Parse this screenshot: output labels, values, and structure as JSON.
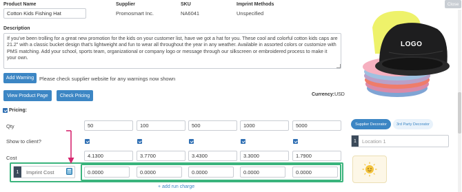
{
  "product": {
    "name_label": "Product Name",
    "name_value": "Cotton Kids Fishing Hat",
    "supplier_label": "Supplier",
    "supplier_value": "Promosmart Inc.",
    "sku_label": "SKU",
    "sku_value": "NA6041",
    "imprint_label": "Imprint Methods",
    "imprint_value": "Unspecified"
  },
  "description": {
    "label": "Description",
    "text": "If you've been trolling for a great new promotion for the kids on your customer list, have we got a hat for you. These cool and colorful cotton kids caps are 21.2\" with a classic bucket design that's lightweight and fun to wear all throughout the year in any weather. Available in assorted colors or customize with PMS matching. Add your school, sports team, organizational or company logo or message through our silkscreen or embroidered process to make it your own."
  },
  "warning": {
    "button": "Add Warning",
    "note": "Please check supplier website for any warnings now shown"
  },
  "actions": {
    "view_product": "View Product Page",
    "check_pricing": "Check Pricing"
  },
  "currency": {
    "label": "Currency:",
    "value": "USD"
  },
  "pricing": {
    "label": "Pricing:",
    "qty_label": "Qty",
    "show_label": "Show to client?",
    "cost_label": "Cost",
    "quantities": [
      "50",
      "100",
      "500",
      "1000",
      "5000"
    ],
    "costs": [
      "4.1300",
      "3.7700",
      "3.4300",
      "3.3000",
      "1.7900"
    ],
    "imprint_index": "1",
    "imprint_label": "Imprint Cost",
    "imprint_costs": [
      "0.0000",
      "0.0000",
      "0.0000",
      "0.0000",
      "0.0000"
    ],
    "add_run_charge": "+ add run charge"
  },
  "image": {
    "close": "Close",
    "logo_text": "LOGO"
  },
  "decorator": {
    "supplier_tab": "Supplier Decorator",
    "third_party_tab": "3rd Party Decorator",
    "location_index": "1",
    "location_placeholder": "Location 1"
  },
  "colors": {
    "accent_blue": "#3c86c4",
    "highlight_green": "#3ab47c",
    "arrow_pink": "#d6266f"
  }
}
